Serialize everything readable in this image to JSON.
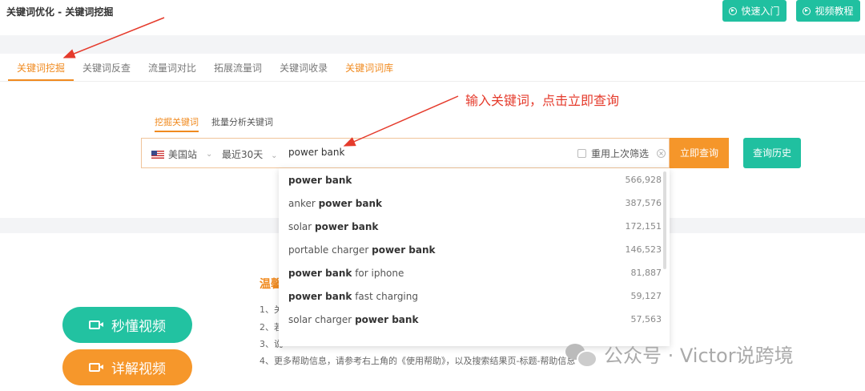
{
  "header": {
    "breadcrumb": "关键词优化 - 关键词挖掘",
    "quick_start": "快速入门",
    "video_tutorial": "视频教程"
  },
  "tabs": [
    {
      "label": "关键词挖掘"
    },
    {
      "label": "关键词反查"
    },
    {
      "label": "流量词对比"
    },
    {
      "label": "拓展流量词"
    },
    {
      "label": "关键词收录"
    },
    {
      "label": "关键词词库"
    }
  ],
  "subtabs": {
    "mine": "挖掘关键词",
    "batch": "批量分析关键词"
  },
  "search": {
    "site": "美国站",
    "period": "最近30天",
    "keyword": "power bank",
    "reuse_filter": "重用上次筛选",
    "query_button": "立即查询",
    "history_button": "查询历史"
  },
  "annotation": "输入关键词，点击立即查询",
  "suggestions": [
    {
      "pre": "",
      "bold": "power bank",
      "post": "",
      "count": "566,928"
    },
    {
      "pre": "anker ",
      "bold": "power bank",
      "post": "",
      "count": "387,576"
    },
    {
      "pre": "solar ",
      "bold": "power bank",
      "post": "",
      "count": "172,151"
    },
    {
      "pre": "portable charger ",
      "bold": "power bank",
      "post": "",
      "count": "146,523"
    },
    {
      "pre": "",
      "bold": "power bank",
      "post": " for iphone",
      "count": "81,887"
    },
    {
      "pre": "",
      "bold": "power bank",
      "post": " fast charging",
      "count": "59,127"
    },
    {
      "pre": "solar charger ",
      "bold": "power bank",
      "post": "",
      "count": "57,563"
    }
  ],
  "tips": {
    "title": "温馨",
    "lines": [
      "1、关",
      "2、若",
      "3、说",
      "4、更多帮助信息，请参考右上角的《使用帮助》，以及搜索结果页-标题-帮助信息"
    ]
  },
  "videos": {
    "quick": "秒懂视频",
    "detail": "详解视频"
  },
  "watermark": "公众号 · Victor说跨境",
  "colors": {
    "accent_orange": "#f08a1f",
    "accent_green": "#20c0a0",
    "annotation_red": "#e53b2c"
  }
}
